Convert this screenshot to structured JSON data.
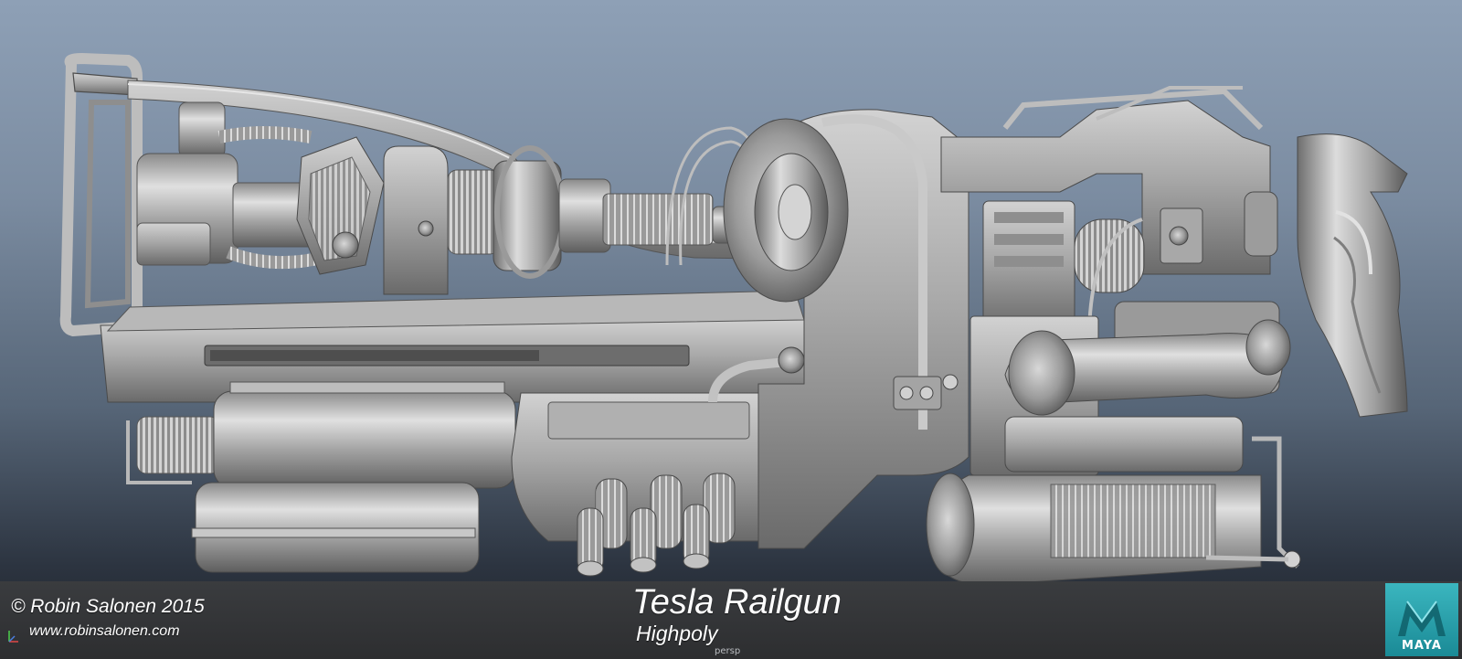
{
  "viewport": {
    "camera_label": "persp",
    "background_top_color": "#8ea0b6",
    "background_bottom_color": "#1e2228"
  },
  "overlay": {
    "copyright": "© Robin Salonen 2015",
    "website": "www.robinsalonen.com",
    "title": "Tesla Railgun",
    "subtitle": "Highpoly"
  },
  "logo": {
    "label": "MAYA",
    "color": "#1f9aa5"
  },
  "model": {
    "shading": "grey-shaded-highpoly",
    "base_color": "#9a9a9a"
  }
}
